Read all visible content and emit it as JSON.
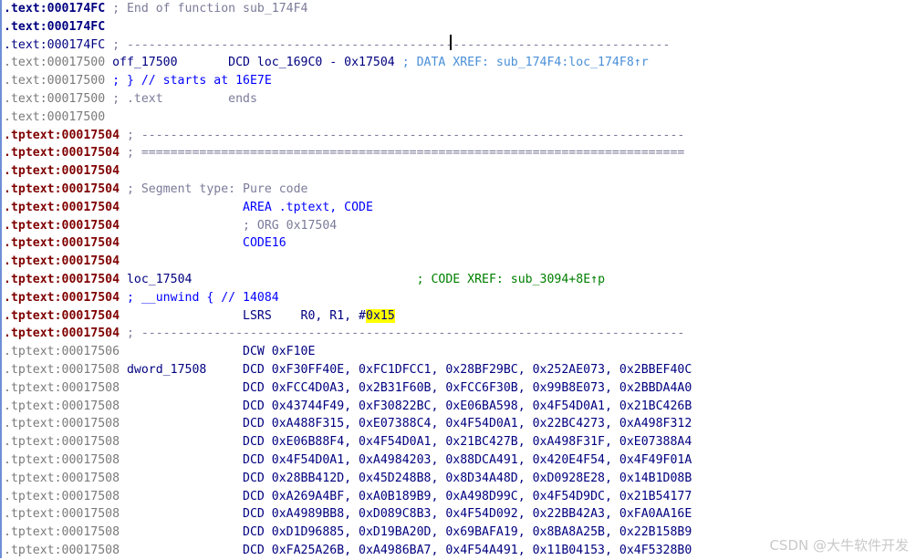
{
  "colors": {
    "addr_text": "#000080",
    "addr_plain": "#7a7a7a",
    "addr_tptext": "#800000",
    "comment": "#7b7b9a",
    "mnemonic": "#0000ff",
    "operand": "#000080",
    "label": "#000080",
    "xref": "#008000",
    "ida_comment": "#4a90d9",
    "highlight": "#ffff00",
    "gutter": "#6e8fd6"
  },
  "lines": [
    {
      "addr": ".text:000174FC",
      "addr_style": "text",
      "bold": true,
      "segments": [
        {
          "t": " ; End of function sub_174F4",
          "c": "comment"
        }
      ]
    },
    {
      "addr": ".text:000174FC",
      "addr_style": "text",
      "bold": true,
      "segments": []
    },
    {
      "addr": ".text:000174FC",
      "addr_style": "text",
      "bold": false,
      "segments": [
        {
          "t": " ; ---------------------------------------------------------------------------",
          "c": "comment"
        }
      ]
    },
    {
      "addr": ".text:00017500",
      "addr_style": "plain",
      "bold": false,
      "segments": [
        {
          "t": " off_17500",
          "c": "label"
        },
        {
          "t": "       DCD loc_169C0 - 0x17504",
          "c": "operand"
        },
        {
          "t": " ; DATA XREF: sub_174F4:loc_174F8↑r",
          "c": "ida_comment"
        }
      ]
    },
    {
      "addr": ".text:00017500",
      "addr_style": "plain",
      "bold": false,
      "segments": [
        {
          "t": " ; } // starts at 16E7E",
          "c": "mnemonic"
        }
      ]
    },
    {
      "addr": ".text:00017500",
      "addr_style": "plain",
      "bold": false,
      "segments": [
        {
          "t": " ; .text         ends",
          "c": "comment"
        }
      ]
    },
    {
      "addr": ".text:00017500",
      "addr_style": "plain",
      "bold": false,
      "segments": []
    },
    {
      "addr": ".tptext:00017504",
      "addr_style": "tptext",
      "bold": false,
      "segments": [
        {
          "t": " ; ---------------------------------------------------------------------------",
          "c": "comment"
        }
      ]
    },
    {
      "addr": ".tptext:00017504",
      "addr_style": "tptext",
      "bold": false,
      "segments": [
        {
          "t": " ; ===========================================================================",
          "c": "comment"
        }
      ]
    },
    {
      "addr": ".tptext:00017504",
      "addr_style": "tptext",
      "bold": false,
      "segments": []
    },
    {
      "addr": ".tptext:00017504",
      "addr_style": "tptext",
      "bold": false,
      "segments": [
        {
          "t": " ; Segment type: Pure code",
          "c": "comment"
        }
      ]
    },
    {
      "addr": ".tptext:00017504",
      "addr_style": "tptext",
      "bold": false,
      "segments": [
        {
          "t": "                 AREA .tptext, CODE",
          "c": "mnemonic"
        }
      ]
    },
    {
      "addr": ".tptext:00017504",
      "addr_style": "tptext",
      "bold": false,
      "segments": [
        {
          "t": "                 ; ORG 0x17504",
          "c": "comment"
        }
      ]
    },
    {
      "addr": ".tptext:00017504",
      "addr_style": "tptext",
      "bold": false,
      "segments": [
        {
          "t": "                 CODE16",
          "c": "mnemonic"
        }
      ]
    },
    {
      "addr": ".tptext:00017504",
      "addr_style": "tptext",
      "bold": false,
      "segments": []
    },
    {
      "addr": ".tptext:00017504",
      "addr_style": "tptext",
      "bold": false,
      "segments": [
        {
          "t": " loc_17504",
          "c": "label"
        },
        {
          "t": "                               ; CODE XREF: sub_3094+8E↑p",
          "c": "xref"
        }
      ]
    },
    {
      "addr": ".tptext:00017504",
      "addr_style": "tptext",
      "bold": false,
      "segments": [
        {
          "t": " ; __unwind { // 14084",
          "c": "mnemonic"
        }
      ]
    },
    {
      "addr": ".tptext:00017504",
      "addr_style": "tptext",
      "bold": false,
      "segments": [
        {
          "t": "                 LSRS    R0, R1, #",
          "c": "operand"
        },
        {
          "t": "0x15",
          "c": "operand",
          "hl": true
        }
      ]
    },
    {
      "addr": ".tptext:00017504",
      "addr_style": "tptext",
      "bold": false,
      "segments": [
        {
          "t": " ; ---------------------------------------------------------------------------",
          "c": "comment"
        }
      ]
    },
    {
      "addr": ".tptext:00017506",
      "addr_style": "plain",
      "bold": false,
      "segments": [
        {
          "t": "                 DCW 0xF10E",
          "c": "operand"
        }
      ]
    },
    {
      "addr": ".tptext:00017508",
      "addr_style": "plain",
      "bold": false,
      "segments": [
        {
          "t": " dword_17508",
          "c": "label"
        },
        {
          "t": "     DCD 0xF30FF40E, 0xFC1DFCC1, 0x28BF29BC, 0x252AE073, 0x2BBEF40C",
          "c": "operand"
        }
      ]
    },
    {
      "addr": ".tptext:00017508",
      "addr_style": "plain",
      "bold": false,
      "segments": [
        {
          "t": "                 DCD 0xFCC4D0A3, 0x2B31F60B, 0xFCC6F30B, 0x99B8E073, 0x2BBDA4A0",
          "c": "operand"
        }
      ]
    },
    {
      "addr": ".tptext:00017508",
      "addr_style": "plain",
      "bold": false,
      "segments": [
        {
          "t": "                 DCD 0x43744F49, 0xF30822BC, 0xE06BA598, 0x4F54D0A1, 0x21BC426B",
          "c": "operand"
        }
      ]
    },
    {
      "addr": ".tptext:00017508",
      "addr_style": "plain",
      "bold": false,
      "segments": [
        {
          "t": "                 DCD 0xA488F315, 0xE07388C4, 0x4F54D0A1, 0x22BC4273, 0xA498F312",
          "c": "operand"
        }
      ]
    },
    {
      "addr": ".tptext:00017508",
      "addr_style": "plain",
      "bold": false,
      "segments": [
        {
          "t": "                 DCD 0xE06B88F4, 0x4F54D0A1, 0x21BC427B, 0xA498F31F, 0xE07388A4",
          "c": "operand"
        }
      ]
    },
    {
      "addr": ".tptext:00017508",
      "addr_style": "plain",
      "bold": false,
      "segments": [
        {
          "t": "                 DCD 0x4F54D0A1, 0xA4984203, 0x88DCA491, 0x420E4F54, 0x4F49F01A",
          "c": "operand"
        }
      ]
    },
    {
      "addr": ".tptext:00017508",
      "addr_style": "plain",
      "bold": false,
      "segments": [
        {
          "t": "                 DCD 0x28BB412D, 0x45D248B8, 0x8D34A48D, 0xD0928E28, 0x14B1D08B",
          "c": "operand"
        }
      ]
    },
    {
      "addr": ".tptext:00017508",
      "addr_style": "plain",
      "bold": false,
      "segments": [
        {
          "t": "                 DCD 0xA269A4BF, 0xA0B189B9, 0xA498D99C, 0x4F54D9DC, 0x21B54177",
          "c": "operand"
        }
      ]
    },
    {
      "addr": ".tptext:00017508",
      "addr_style": "plain",
      "bold": false,
      "segments": [
        {
          "t": "                 DCD 0xA4989BB8, 0xD089C8B3, 0x4F54D092, 0x22BB42A3, 0xFA0AA16E",
          "c": "operand"
        }
      ]
    },
    {
      "addr": ".tptext:00017508",
      "addr_style": "plain",
      "bold": false,
      "segments": [
        {
          "t": "                 DCD 0xD1D96885, 0xD19BA20D, 0x69BAFA19, 0x8BA8A25B, 0x22B158B9",
          "c": "operand"
        }
      ]
    },
    {
      "addr": ".tptext:00017508",
      "addr_style": "plain",
      "bold": false,
      "segments": [
        {
          "t": "                 DCD 0xFA25A26B, 0xA4986BA7, 0x4F54A491, 0x11B04153, 0x4F5328B0",
          "c": "operand"
        }
      ]
    }
  ],
  "watermark": "CSDN @大牛软件开发"
}
